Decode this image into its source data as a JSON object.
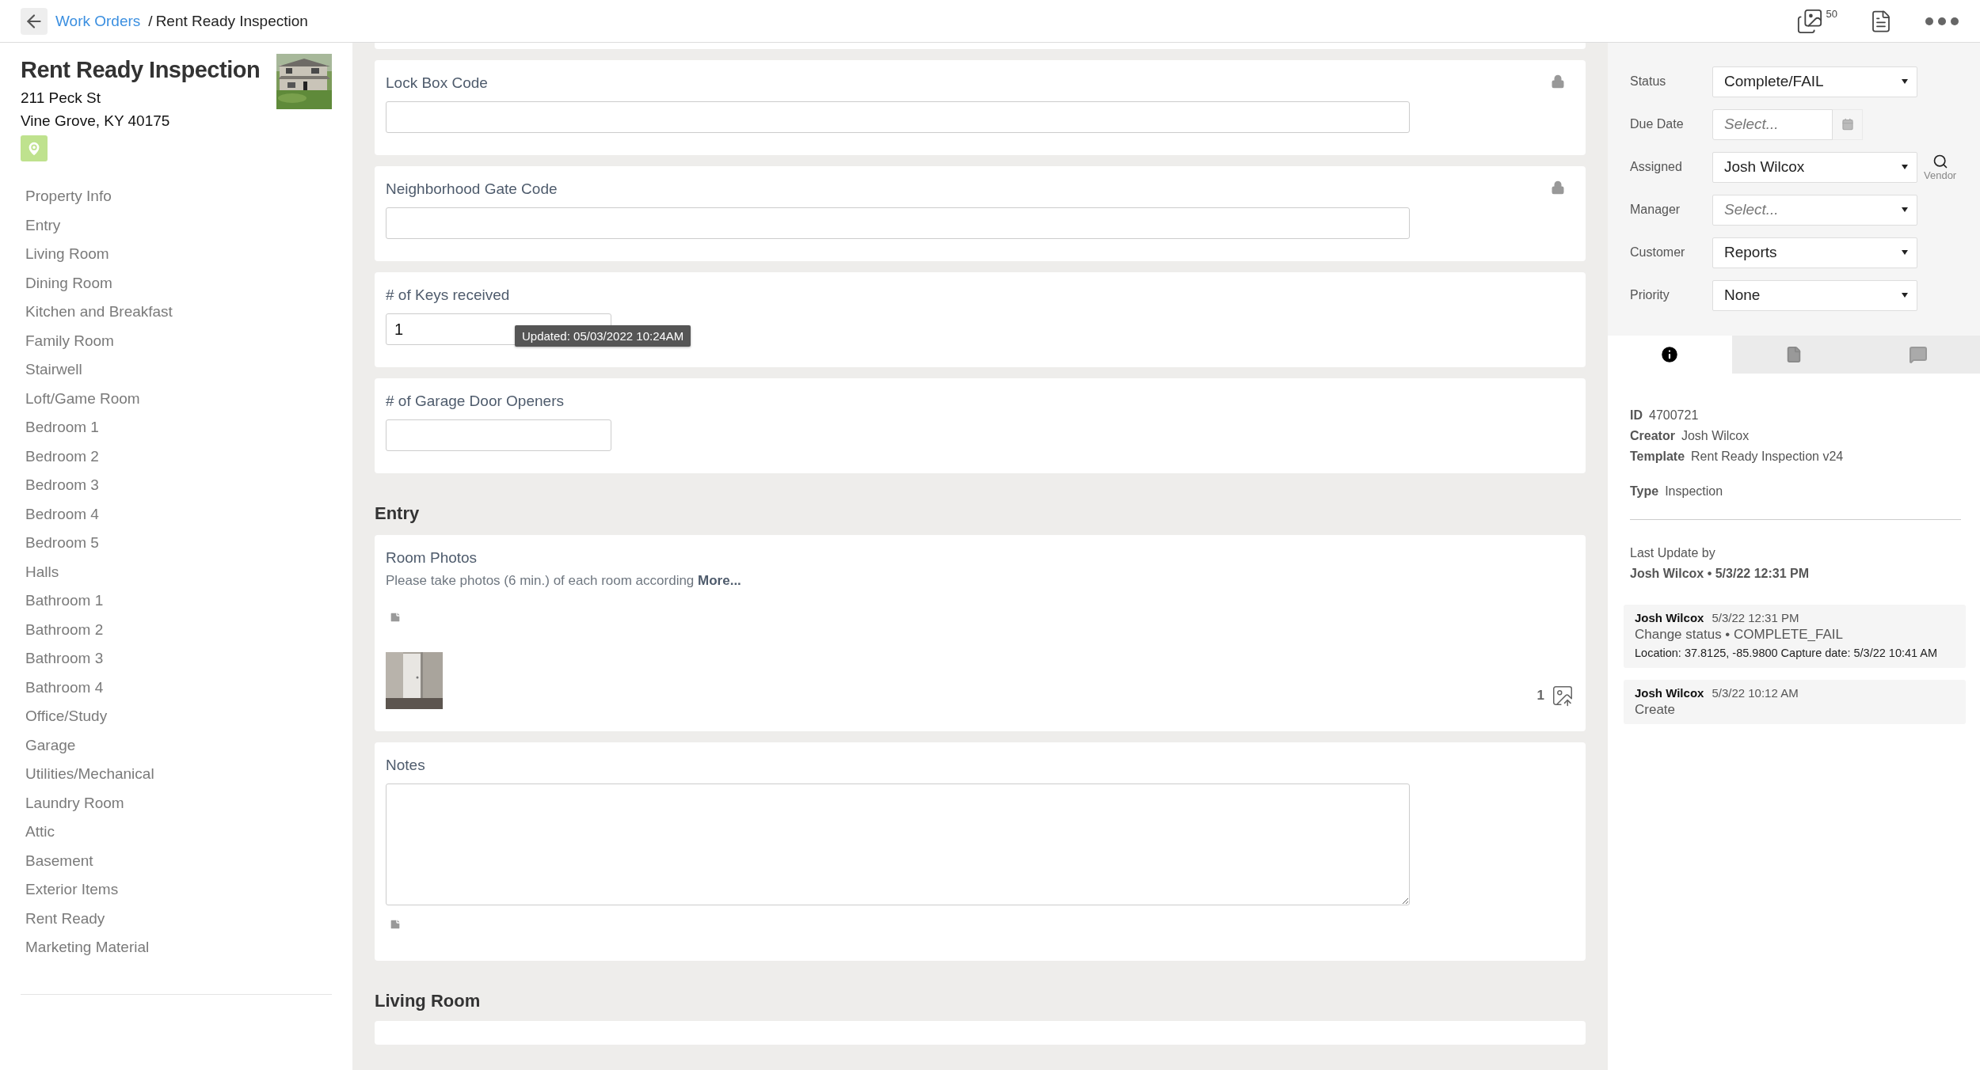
{
  "breadcrumb": {
    "parent": "Work Orders",
    "separator": "/",
    "current": "Rent Ready Inspection"
  },
  "toolbar": {
    "photo_count": "50"
  },
  "property": {
    "title": "Rent Ready Inspection",
    "address_line1": "211 Peck St",
    "address_line2": "Vine Grove, KY 40175"
  },
  "nav": [
    {
      "label": "Property Info"
    },
    {
      "label": "Entry"
    },
    {
      "label": "Living Room"
    },
    {
      "label": "Dining Room"
    },
    {
      "label": "Kitchen and Breakfast"
    },
    {
      "label": "Family Room"
    },
    {
      "label": "Stairwell"
    },
    {
      "label": "Loft/Game Room"
    },
    {
      "label": "Bedroom 1"
    },
    {
      "label": "Bedroom 2"
    },
    {
      "label": "Bedroom 3"
    },
    {
      "label": "Bedroom 4"
    },
    {
      "label": "Bedroom 5"
    },
    {
      "label": "Halls"
    },
    {
      "label": "Bathroom 1"
    },
    {
      "label": "Bathroom 2"
    },
    {
      "label": "Bathroom 3"
    },
    {
      "label": "Bathroom 4"
    },
    {
      "label": "Office/Study"
    },
    {
      "label": "Garage"
    },
    {
      "label": "Utilities/Mechanical"
    },
    {
      "label": "Laundry Room"
    },
    {
      "label": "Attic"
    },
    {
      "label": "Basement"
    },
    {
      "label": "Exterior Items"
    },
    {
      "label": "Rent Ready"
    },
    {
      "label": "Marketing Material"
    }
  ],
  "main": [
    {
      "kind": "stub"
    },
    {
      "kind": "field",
      "label": "Lock Box Code",
      "wide": true,
      "locked": true
    },
    {
      "kind": "field",
      "label": "Neighborhood Gate Code",
      "wide": true,
      "locked": true
    },
    {
      "kind": "field",
      "label": "# of Keys received",
      "wide": false,
      "locked": false,
      "value": "1",
      "tooltip": "Updated: 05/03/2022 10:24AM"
    },
    {
      "kind": "field",
      "label": "# of Garage Door Openers",
      "wide": false,
      "locked": false
    },
    {
      "kind": "heading",
      "text": "Entry"
    },
    {
      "kind": "photos",
      "label": "Room Photos",
      "description": "Please take photos (6 min.) of each room according",
      "more": "More...",
      "count": "1"
    },
    {
      "kind": "notes",
      "label": "Notes"
    },
    {
      "kind": "heading",
      "text": "Living Room"
    },
    {
      "kind": "stub"
    }
  ],
  "properties": [
    {
      "kind": "select",
      "label": "Status",
      "value": "Complete/FAIL"
    },
    {
      "kind": "date",
      "label": "Due Date",
      "placeholder": "Select..."
    },
    {
      "kind": "select",
      "label": "Assigned",
      "value": "Josh Wilcox",
      "vendor": "Vendor"
    },
    {
      "kind": "select",
      "label": "Manager",
      "placeholder": "Select..."
    },
    {
      "kind": "select",
      "label": "Customer",
      "value": "Reports"
    },
    {
      "kind": "select",
      "label": "Priority",
      "value": "None"
    }
  ],
  "tabs": [
    {
      "kind": "info",
      "selected": true
    },
    {
      "kind": "file",
      "selected": false
    },
    {
      "kind": "comment",
      "selected": false
    }
  ],
  "info_groups": [
    [
      {
        "label": "ID",
        "value": "4700721"
      },
      {
        "label": "Creator",
        "value": "Josh Wilcox"
      },
      {
        "label": "Template",
        "value": "Rent Ready Inspection v24"
      }
    ],
    [
      {
        "label": "Type",
        "value": "Inspection"
      }
    ]
  ],
  "last_update": {
    "label": "Last Update by",
    "value": "Josh Wilcox • 5/3/22 12:31 PM"
  },
  "activity": [
    {
      "author": "Josh Wilcox",
      "time": "5/3/22 12:31 PM",
      "text": "Change status • COMPLETE_FAIL",
      "detail": "Location: 37.8125, -85.9800 Capture date: 5/3/22 10:41 AM"
    },
    {
      "author": "Josh Wilcox",
      "time": "5/3/22 10:12 AM",
      "text": "Create"
    }
  ]
}
